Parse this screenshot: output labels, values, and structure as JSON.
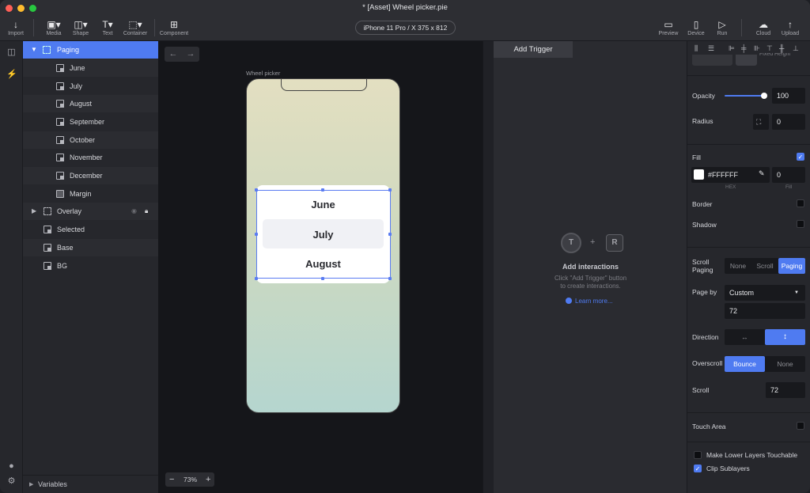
{
  "window": {
    "title": "* [Asset] Wheel picker.pie",
    "device": "iPhone 11 Pro / X  375 x 812"
  },
  "toolbar": {
    "left": [
      {
        "label": "Import",
        "icon": "arrow-down-icon"
      },
      {
        "label": "Media",
        "icon": "media-icon"
      },
      {
        "label": "Shape",
        "icon": "shape-icon"
      },
      {
        "label": "Text",
        "icon": "text-icon"
      },
      {
        "label": "Container",
        "icon": "container-icon"
      },
      {
        "label": "Component",
        "icon": "component-icon"
      }
    ],
    "right": [
      {
        "label": "Preview",
        "icon": "preview-icon"
      },
      {
        "label": "Device",
        "icon": "device-icon"
      },
      {
        "label": "Run",
        "icon": "play-icon"
      },
      {
        "label": "Cloud",
        "icon": "cloud-icon"
      },
      {
        "label": "Upload",
        "icon": "upload-icon"
      }
    ]
  },
  "layers": [
    {
      "label": "Paging",
      "selected": true
    },
    {
      "label": "June"
    },
    {
      "label": "July"
    },
    {
      "label": "August"
    },
    {
      "label": "September"
    },
    {
      "label": "October"
    },
    {
      "label": "November"
    },
    {
      "label": "December"
    },
    {
      "label": "Margin"
    },
    {
      "label": "Overlay"
    },
    {
      "label": "Selected"
    },
    {
      "label": "Base"
    },
    {
      "label": "BG"
    }
  ],
  "variables_label": "Variables",
  "canvas": {
    "frame_label": "Wheel picker",
    "zoom": "73%",
    "picker_items": [
      "June",
      "July",
      "August"
    ]
  },
  "interactions": {
    "add_trigger": "Add Trigger",
    "t": "T",
    "plus": "+",
    "r": "R",
    "heading": "Add interactions",
    "desc1": "Click \"Add Trigger\" button",
    "desc2": "to create interactions.",
    "learn_more": "Learn more..."
  },
  "props": {
    "opacity_label": "Opacity",
    "opacity_value": "100",
    "opacity_level": 1.0,
    "radius_label": "Radius",
    "radius_value": "0",
    "fill_label": "Fill",
    "fill_hex": "#FFFFFF",
    "fill_value": "0",
    "hex_caption": "HEX",
    "fill_caption": "Fill",
    "border_label": "Border",
    "shadow_label": "Shadow",
    "scroll_paging_label1": "Scroll",
    "scroll_paging_label2": "Paging",
    "scroll_paging_options": [
      "None",
      "Scroll",
      "Paging"
    ],
    "page_by_label": "Page by",
    "page_by_value": "Custom",
    "page_size": "72",
    "direction_label": "Direction",
    "direction_h": "↔",
    "direction_v": "↕",
    "overscroll_label": "Overscroll",
    "overscroll_options": [
      "Bounce",
      "None"
    ],
    "scroll_label": "Scroll",
    "scroll_value": "72",
    "touch_area_label": "Touch Area",
    "make_lower_label": "Make Lower Layers Touchable",
    "clip_label": "Clip Sublayers",
    "fixed_height": "Fixed Height"
  },
  "colors": {
    "accent": "#4f7bf1",
    "bg": "#232429",
    "panel": "#26272c"
  }
}
